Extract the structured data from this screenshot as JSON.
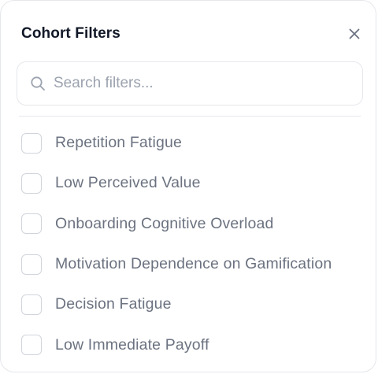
{
  "header": {
    "title": "Cohort Filters"
  },
  "search": {
    "placeholder": "Search filters...",
    "value": ""
  },
  "filters": [
    {
      "label": "Repetition Fatigue",
      "checked": false
    },
    {
      "label": "Low Perceived Value",
      "checked": false
    },
    {
      "label": "Onboarding Cognitive Overload",
      "checked": false
    },
    {
      "label": "Motivation Dependence on Gamification",
      "checked": false
    },
    {
      "label": "Decision Fatigue",
      "checked": false
    },
    {
      "label": "Low Immediate Payoff",
      "checked": false
    }
  ],
  "icons": {
    "close": "close-icon",
    "search": "search-icon"
  },
  "colors": {
    "title": "#111827",
    "label": "#6b7280",
    "placeholder": "#9ca3af",
    "border": "#e5e7eb"
  }
}
